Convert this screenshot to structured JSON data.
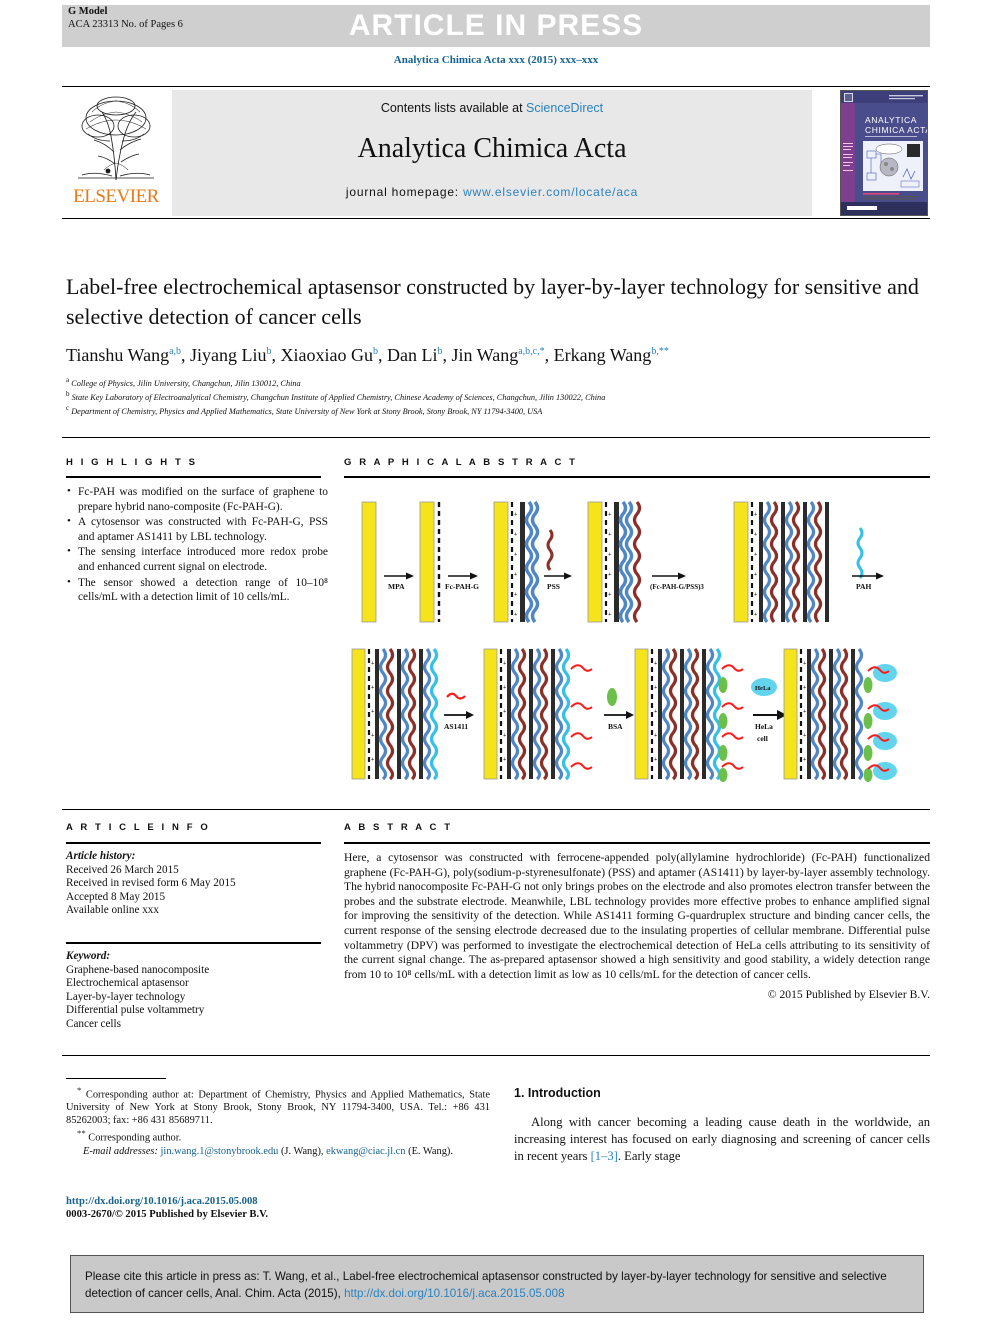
{
  "banner": {
    "article_in_press": "ARTICLE IN PRESS",
    "g_model": "G Model",
    "model_code": "ACA 23313 No. of Pages 6",
    "journal_ref": "Analytica Chimica Acta xxx (2015) xxx–xxx"
  },
  "masthead": {
    "contents_prefix": "Contents lists available at ",
    "sciencedirect": "ScienceDirect",
    "journal_name": "Analytica Chimica Acta",
    "homepage_label": "journal homepage: ",
    "homepage_url": "www.elsevier.com/locate/aca",
    "publisher": "ELSEVIER",
    "cover_title_line1": "ANALYTICA",
    "cover_title_line2": "CHIMICA ACTA"
  },
  "article": {
    "title": "Label-free electrochemical aptasensor constructed by layer-by-layer technology for sensitive and selective detection of cancer cells",
    "authors": [
      {
        "name": "Tianshu Wang",
        "sup": "a,b"
      },
      {
        "name": "Jiyang Liu",
        "sup": "b"
      },
      {
        "name": "Xiaoxiao Gu",
        "sup": "b"
      },
      {
        "name": "Dan Li",
        "sup": "b"
      },
      {
        "name": "Jin Wang",
        "sup": "a,b,c,*"
      },
      {
        "name": "Erkang Wang",
        "sup": "b,**"
      }
    ],
    "affiliations": [
      {
        "marker": "a",
        "text": "College of Physics, Jilin University, Changchun, Jilin 130012, China"
      },
      {
        "marker": "b",
        "text": "State Key Laboratory of Electroanalytical Chemistry, Changchun Institute of Applied Chemistry, Chinese Academy of Sciences, Changchun, Jilin 130022, China"
      },
      {
        "marker": "c",
        "text": "Department of Chemistry, Physics and Applied Mathematics, State University of New York at Stony Brook, Stony Brook, NY 11794-3400, USA"
      }
    ]
  },
  "highlights": {
    "heading": "H I G H L I G H T S",
    "items": [
      "Fc-PAH was modified on the surface of graphene to prepare hybrid nano-composite (Fc-PAH-G).",
      "A cytosensor was constructed with Fc-PAH-G, PSS and aptamer AS1411 by LBL technology.",
      "The sensing interface introduced more redox probe and enhanced current signal on electrode.",
      "The sensor showed a detection range of 10–10⁸ cells/mL with a detection limit of 10 cells/mL."
    ]
  },
  "graphical_abstract": {
    "heading": "G R A P H I C A L   A B S T R A C T",
    "row1_arrows": [
      "MPA",
      "Fc-PAH-G",
      "PSS",
      "(Fc-PAH-G/PSS)3",
      "PAH"
    ],
    "row2_arrows": [
      "AS1411",
      "BSA",
      "HeLa cell"
    ],
    "cell_label": "HeLa",
    "colors": {
      "electrode": "#f5e31c",
      "pah": "#4f86c6",
      "graphene": "#2b2b2b",
      "pss": "#8a3028",
      "aptamer": "#ff1a1a",
      "bsa": "#6bbf4a",
      "cell": "#63d4ee"
    }
  },
  "article_info": {
    "heading": "A R T I C L E   I N F O",
    "history_label": "Article history:",
    "history": [
      "Received 26 March 2015",
      "Received in revised form 6 May 2015",
      "Accepted 8 May 2015",
      "Available online xxx"
    ],
    "keyword_label": "Keyword:",
    "keywords": [
      "Graphene-based nanocomposite",
      "Electrochemical aptasensor",
      "Layer-by-layer technology",
      "Differential pulse voltammetry",
      "Cancer cells"
    ]
  },
  "abstract": {
    "heading": "A B S T R A C T",
    "body": "Here, a cytosensor was constructed with ferrocene-appended poly(allylamine hydrochloride) (Fc-PAH) functionalized graphene (Fc-PAH-G), poly(sodium-p-styrenesulfonate) (PSS) and aptamer (AS1411) by layer-by-layer assembly technology. The hybrid nanocomposite Fc-PAH-G not only brings probes on the electrode and also promotes electron transfer between the probes and the substrate electrode. Meanwhile, LBL technology provides more effective probes to enhance amplified signal for improving the sensitivity of the detection. While AS1411 forming G-quardruplex structure and binding cancer cells, the current response of the sensing electrode decreased due to the insulating properties of cellular membrane. Differential pulse voltammetry (DPV) was performed to investigate the electrochemical detection of HeLa cells attributing to its sensitivity of the current signal change. The as-prepared aptasensor showed a high sensitivity and good stability, a widely detection range from 10 to 10⁸ cells/mL with a detection limit as low as 10 cells/mL for the detection of cancer cells.",
    "copyright": "© 2015 Published by Elsevier B.V."
  },
  "footnotes": {
    "corresponding1": "Corresponding author at: Department of Chemistry, Physics and Applied Mathematics, State University of New York at Stony Brook, Stony Brook, NY 11794-3400, USA. Tel.: +86 431 85262003; fax: +86 431 85689711.",
    "corresponding2": "Corresponding author.",
    "email_label": "E-mail addresses:",
    "email1": "jin.wang.1@stonybrook.edu",
    "email1_name": "(J. Wang),",
    "email2": "ekwang@ciac.jl.cn",
    "email2_name": "(E. Wang).",
    "doi": "http://dx.doi.org/10.1016/j.aca.2015.05.008",
    "issn": "0003-2670/© 2015 Published by Elsevier B.V."
  },
  "introduction": {
    "heading": "1. Introduction",
    "paragraph_pre": "Along with cancer becoming a leading cause death in the worldwide, an increasing interest has focused on early diagnosing and screening of cancer cells in recent years ",
    "citation": "[1–3]",
    "paragraph_post": ". Early stage"
  },
  "cite_footer": {
    "text_pre": "Please cite this article in press as: T. Wang, et al., Label-free electrochemical aptasensor constructed by layer-by-layer technology for sensitive and selective detection of cancer cells, Anal. Chim. Acta (2015), ",
    "link": "http://dx.doi.org/10.1016/j.aca.2015.05.008"
  }
}
